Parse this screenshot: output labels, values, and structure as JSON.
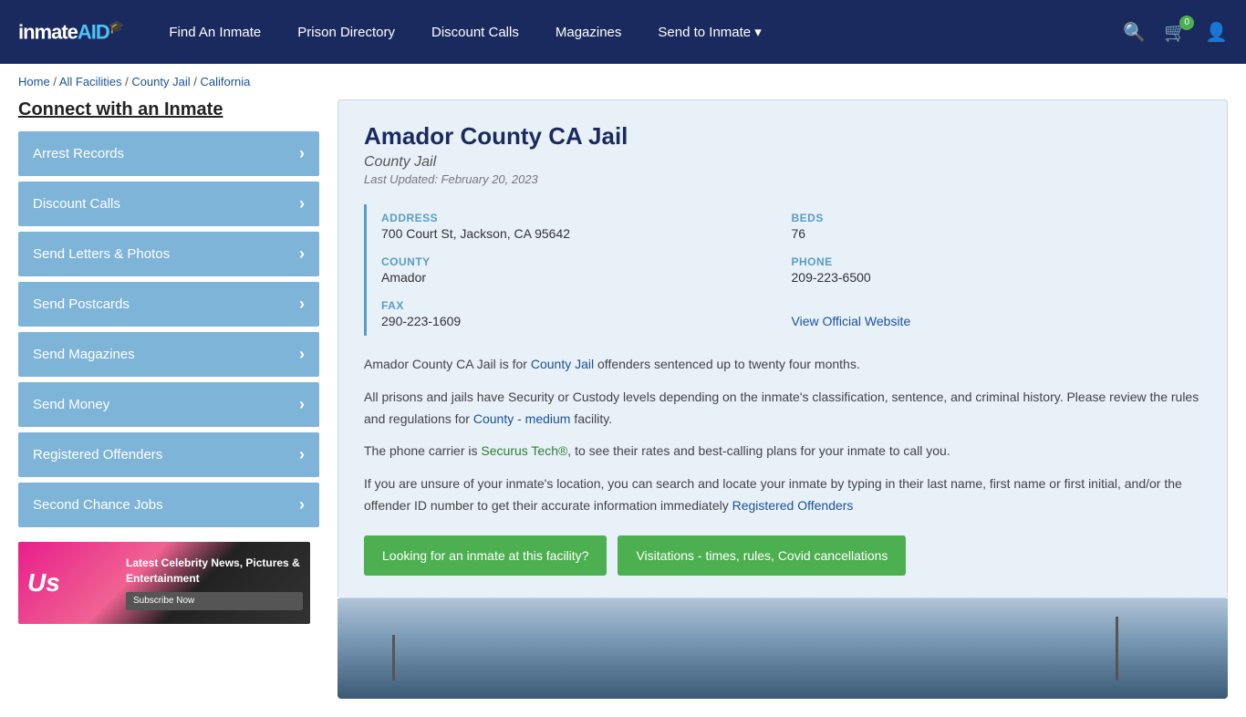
{
  "header": {
    "logo": "inmateAID",
    "cart_badge": "0",
    "nav": [
      {
        "label": "Find An Inmate",
        "id": "find-inmate"
      },
      {
        "label": "Prison Directory",
        "id": "prison-directory"
      },
      {
        "label": "Discount Calls",
        "id": "discount-calls"
      },
      {
        "label": "Magazines",
        "id": "magazines"
      },
      {
        "label": "Send to Inmate ▾",
        "id": "send-to-inmate"
      }
    ]
  },
  "breadcrumb": {
    "items": [
      "Home",
      "All Facilities",
      "County Jail",
      "California"
    ]
  },
  "sidebar": {
    "title": "Connect with an Inmate",
    "items": [
      {
        "label": "Arrest Records"
      },
      {
        "label": "Discount Calls"
      },
      {
        "label": "Send Letters & Photos"
      },
      {
        "label": "Send Postcards"
      },
      {
        "label": "Send Magazines"
      },
      {
        "label": "Send Money"
      },
      {
        "label": "Registered Offenders"
      },
      {
        "label": "Second Chance Jobs"
      }
    ]
  },
  "ad": {
    "logo": "Us",
    "headline": "Latest Celebrity News, Pictures & Entertainment",
    "button": "Subscribe Now"
  },
  "facility": {
    "name": "Amador County CA Jail",
    "type": "County Jail",
    "updated": "Last Updated: February 20, 2023",
    "address_label": "ADDRESS",
    "address_value": "700 Court St, Jackson, CA 95642",
    "beds_label": "BEDS",
    "beds_value": "76",
    "county_label": "COUNTY",
    "county_value": "Amador",
    "phone_label": "PHONE",
    "phone_value": "209-223-6500",
    "fax_label": "FAX",
    "fax_value": "290-223-1609",
    "website_label": "View Official Website",
    "desc1": "Amador County CA Jail is for County Jail offenders sentenced up to twenty four months.",
    "desc2": "All prisons and jails have Security or Custody levels depending on the inmate's classification, sentence, and criminal history. Please review the rules and regulations for County - medium facility.",
    "desc3": "The phone carrier is Securus Tech®, to see their rates and best-calling plans for your inmate to call you.",
    "desc4": "If you are unsure of your inmate's location, you can search and locate your inmate by typing in their last name, first name or first initial, and/or the offender ID number to get their accurate information immediately Registered Offenders",
    "btn1": "Looking for an inmate at this facility?",
    "btn2": "Visitations - times, rules, Covid cancellations"
  }
}
